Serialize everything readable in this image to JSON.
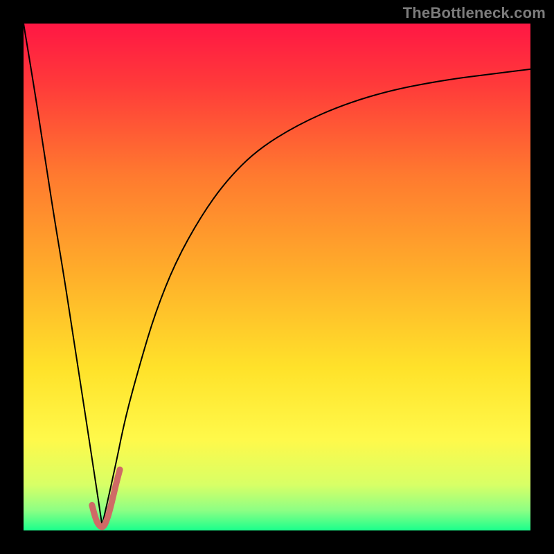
{
  "attribution": "TheBottleneck.com",
  "chart_data": {
    "type": "line",
    "title": "",
    "xlabel": "",
    "ylabel": "",
    "xlim": [
      0,
      100
    ],
    "ylim": [
      0,
      100
    ],
    "grid": false,
    "legend": false,
    "background": {
      "type": "vertical-gradient",
      "stops": [
        {
          "pos": 0.0,
          "color": "#ff1744"
        },
        {
          "pos": 0.12,
          "color": "#ff3a3a"
        },
        {
          "pos": 0.3,
          "color": "#ff7a2f"
        },
        {
          "pos": 0.5,
          "color": "#ffb02a"
        },
        {
          "pos": 0.68,
          "color": "#ffe22a"
        },
        {
          "pos": 0.82,
          "color": "#fff94a"
        },
        {
          "pos": 0.91,
          "color": "#d8ff66"
        },
        {
          "pos": 0.96,
          "color": "#8eff84"
        },
        {
          "pos": 1.0,
          "color": "#1aff8c"
        }
      ]
    },
    "series": [
      {
        "name": "left-descent",
        "color": "#000000",
        "width": 2,
        "x": [
          0,
          2,
          4,
          6,
          8,
          10,
          12,
          14,
          15.5
        ],
        "y": [
          100,
          88,
          75,
          62,
          50,
          37,
          24,
          11,
          1
        ]
      },
      {
        "name": "right-rise",
        "color": "#000000",
        "width": 2,
        "x": [
          15.5,
          18,
          20,
          23,
          26,
          30,
          35,
          40,
          46,
          54,
          63,
          73,
          84,
          92,
          100
        ],
        "y": [
          1,
          12,
          22,
          33,
          43,
          53,
          62,
          69,
          75,
          80,
          84,
          87,
          89,
          90,
          91
        ]
      },
      {
        "name": "marker-hook",
        "color": "#cf6a66",
        "width": 9,
        "x": [
          13.5,
          14.2,
          15.0,
          15.8,
          16.6,
          17.4,
          18.2,
          19.0
        ],
        "y": [
          5.0,
          2.2,
          0.8,
          0.6,
          2.5,
          5.5,
          9.0,
          12.0
        ]
      }
    ]
  }
}
